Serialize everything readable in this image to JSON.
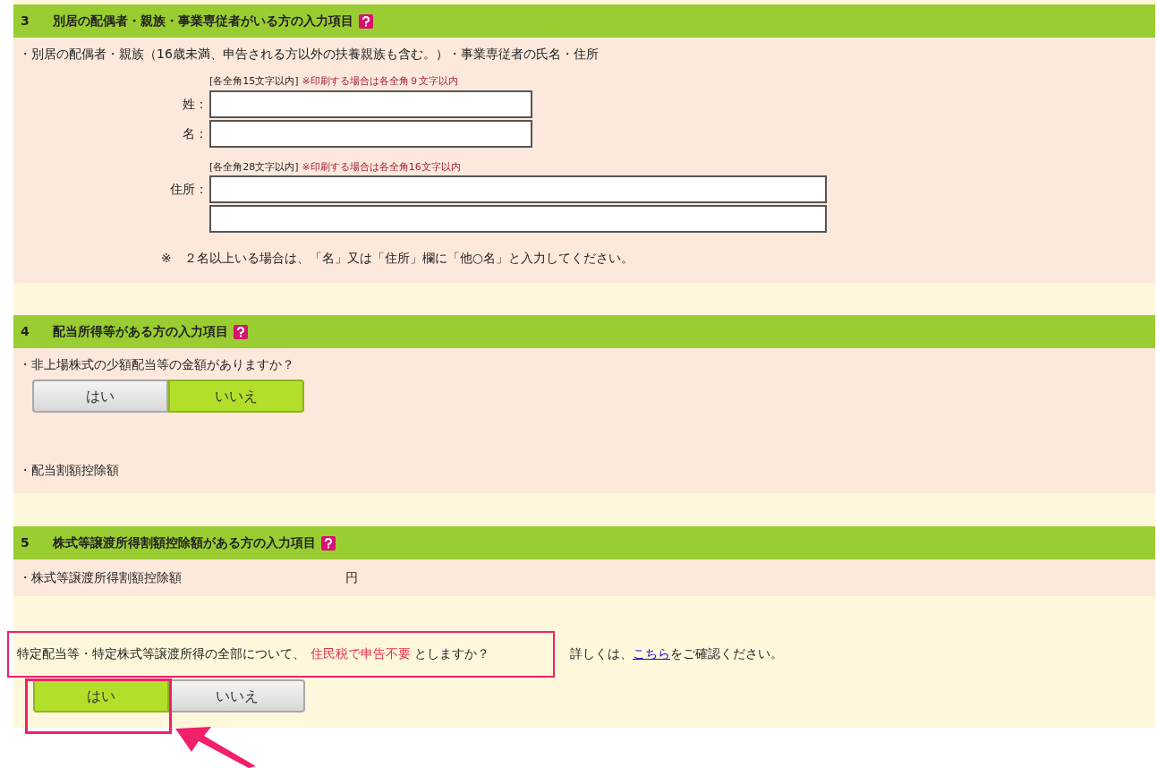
{
  "sections": [
    {
      "number": "3",
      "title": "別居の配偶者・親族・事業専従者がいる方の入力項目",
      "intro": "・別居の配偶者・親族（16歳未満、申告される方以外の扶養親族も含む。）・事業専従者の氏名・住所",
      "field_groups": [
        {
          "limit": "[各全角15文字以内]",
          "print_note": "※印刷する場合は各全角９文字以内",
          "fields": [
            {
              "label": "姓：",
              "kind": "short"
            },
            {
              "label": "名：",
              "kind": "short"
            }
          ]
        },
        {
          "limit": "[各全角28文字以内]",
          "print_note": "※印刷する場合は各全角16文字以内",
          "fields": [
            {
              "label": "住所：",
              "kind": "long"
            },
            {
              "kind": "long"
            }
          ]
        }
      ],
      "note": "※　２名以上いる場合は、「名」又は「住所」欄に「他○名」と入力してください。"
    },
    {
      "number": "4",
      "title": "配当所得等がある方の入力項目",
      "question": "・非上場株式の少額配当等の金額がありますか？",
      "toggle": [
        {
          "label": "はい",
          "selected": false
        },
        {
          "label": "いいえ",
          "selected": true
        }
      ],
      "rows": [
        {
          "label": "・配当割額控除額"
        }
      ]
    },
    {
      "number": "5",
      "title": "株式等譲渡所得割額控除額がある方の入力項目",
      "rows": [
        {
          "label": "・株式等譲渡所得割額控除額",
          "unit": "円"
        }
      ]
    }
  ],
  "final": {
    "question_before": "特定配当等・特定株式等譲渡所得の全部について、",
    "question_highlight": "住民税で申告不要",
    "question_after": "としますか？",
    "detail_before": "詳しくは、",
    "detail_link": "こちら",
    "detail_after": "をご確認ください。",
    "toggle": [
      {
        "label": "はい",
        "selected": true
      },
      {
        "label": "いいえ",
        "selected": false
      }
    ]
  }
}
